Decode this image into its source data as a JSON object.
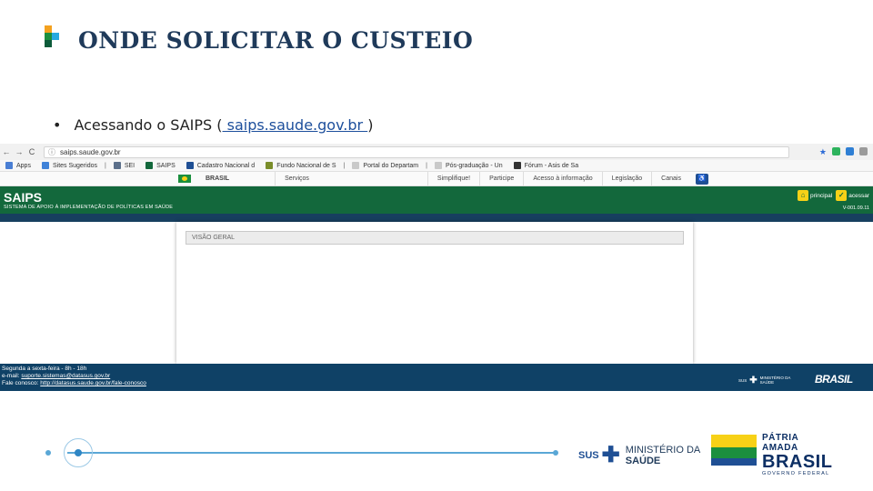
{
  "slide": {
    "title": "ONDE SOLICITAR O CUSTEIO",
    "bullet_text": "Acessando o SAIPS (",
    "bullet_link": " saips.saude.gov.br ",
    "bullet_close": ")",
    "bullet_glyph": "•"
  },
  "browser": {
    "back": "←",
    "forward": "→",
    "reload": "C",
    "info_icon": "ⓘ",
    "url": "saips.saude.gov.br",
    "star": "★",
    "bookmarks": [
      {
        "label": "Apps",
        "color": "#4a7fd4"
      },
      {
        "label": "Sites Sugeridos",
        "color": "#3f82d8"
      },
      {
        "label": "SEI",
        "color": "#5b6f8a"
      },
      {
        "label": "SAIPS",
        "color": "#13683c"
      },
      {
        "label": "Cadastro Nacional d",
        "color": "#1f4f94"
      },
      {
        "label": "Fundo Nacional de S",
        "color": "#7a8d2a"
      },
      {
        "label": "Portal do Departam",
        "color": "#c9c9c9"
      },
      {
        "label": "Pós-graduação - Un",
        "color": "#c9c9c9"
      },
      {
        "label": "Fórum - Asis de Sa",
        "color": "#333333"
      }
    ]
  },
  "gov": {
    "brasil": "BRASIL",
    "servicos": "Serviços",
    "links": [
      "Simplifique!",
      "Participe",
      "Acesso à informação",
      "Legislação",
      "Canais"
    ],
    "access_icon": "♿"
  },
  "saips": {
    "name": "SAIPS",
    "subtitle": "SISTEMA DE APOIO À IMPLEMENTAÇÃO DE POLÍTICAS EM SAÚDE",
    "principal": "principal",
    "acessar": "acessar",
    "version": "V-001.09.11",
    "panel_title": "VISÃO GERAL",
    "footer_l1": "Segunda a sexta-feira - 8h - 18h",
    "footer_l2_label": "e-mail:",
    "footer_l2_email": "suporte.sistemas@datasus.gov.br",
    "footer_l3_label": "Fale conosco:",
    "footer_l3_link": "http://datasus.saude.gov.br/fale-conosco",
    "footer_sus": "SUS",
    "footer_ms_1": "MINISTÉRIO DA",
    "footer_ms_2": "SAÚDE",
    "footer_brasil": "BRASIL"
  },
  "branding": {
    "sus": "SUS",
    "ministerio": "MINISTÉRIO DA",
    "saude": "SAÚDE",
    "patria": "PÁTRIA AMADA",
    "brasil": "BRASIL",
    "governo": "GOVERNO FEDERAL"
  }
}
